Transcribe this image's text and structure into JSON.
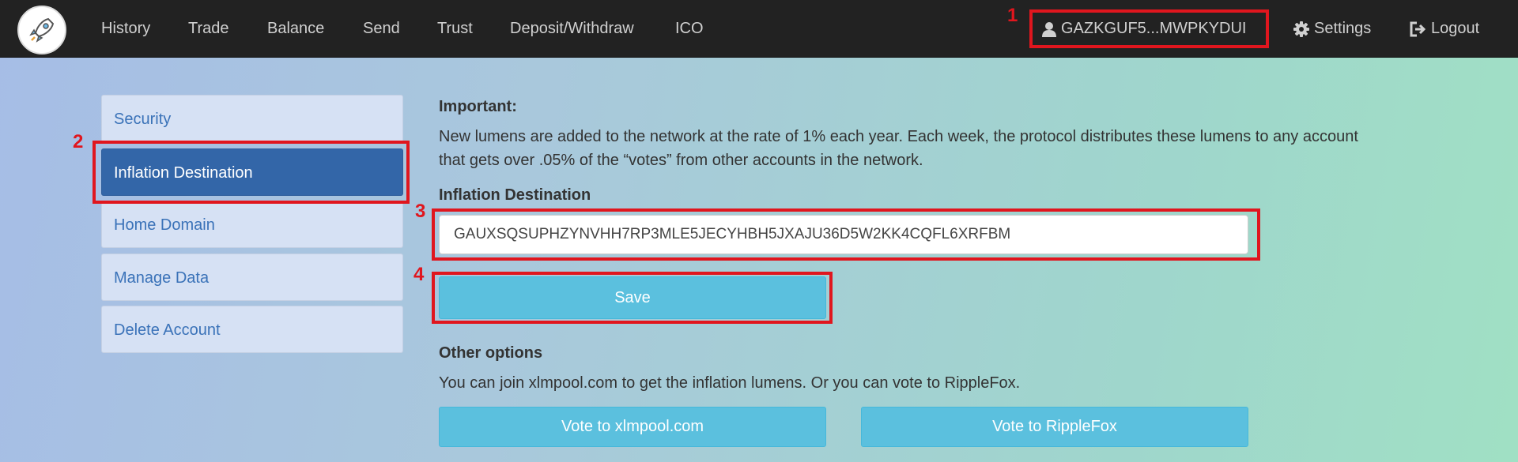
{
  "navbar": {
    "logo_icon": "rocket-icon",
    "links": [
      "History",
      "Trade",
      "Balance",
      "Send",
      "Trust",
      "Deposit/Withdraw",
      "ICO"
    ],
    "account": "GAZKGUF5...MWPKYDUI",
    "settings": "Settings",
    "logout": "Logout"
  },
  "sidebar": {
    "items": [
      {
        "label": "Security"
      },
      {
        "label": "Inflation Destination"
      },
      {
        "label": "Home Domain"
      },
      {
        "label": "Manage Data"
      },
      {
        "label": "Delete Account"
      }
    ]
  },
  "main": {
    "important_heading": "Important:",
    "important_line1": "New lumens are added to the network at the rate of 1% each year. Each week, the protocol distributes these lumens to any account",
    "important_line2": "that gets over .05% of the “votes” from other accounts in the network.",
    "inflation_label": "Inflation Destination",
    "inflation_value": "GAUXSQSUPHZYNVHH7RP3MLE5JECYHBH5JXAJU36D5W2KK4CQFL6XRFBM",
    "save_label": "Save",
    "other_heading": "Other options",
    "other_text": "You can join xlmpool.com to get the inflation lumens. Or you can vote to RippleFox.",
    "vote_xlmpool": "Vote to xlmpool.com",
    "vote_ripplefox": "Vote to RippleFox"
  },
  "annotations": [
    "1",
    "2",
    "3",
    "4"
  ],
  "colors": {
    "annotation": "#e0161e",
    "active_sidebar": "#3366a8",
    "button": "#5bc0de",
    "navbar": "#222222"
  }
}
